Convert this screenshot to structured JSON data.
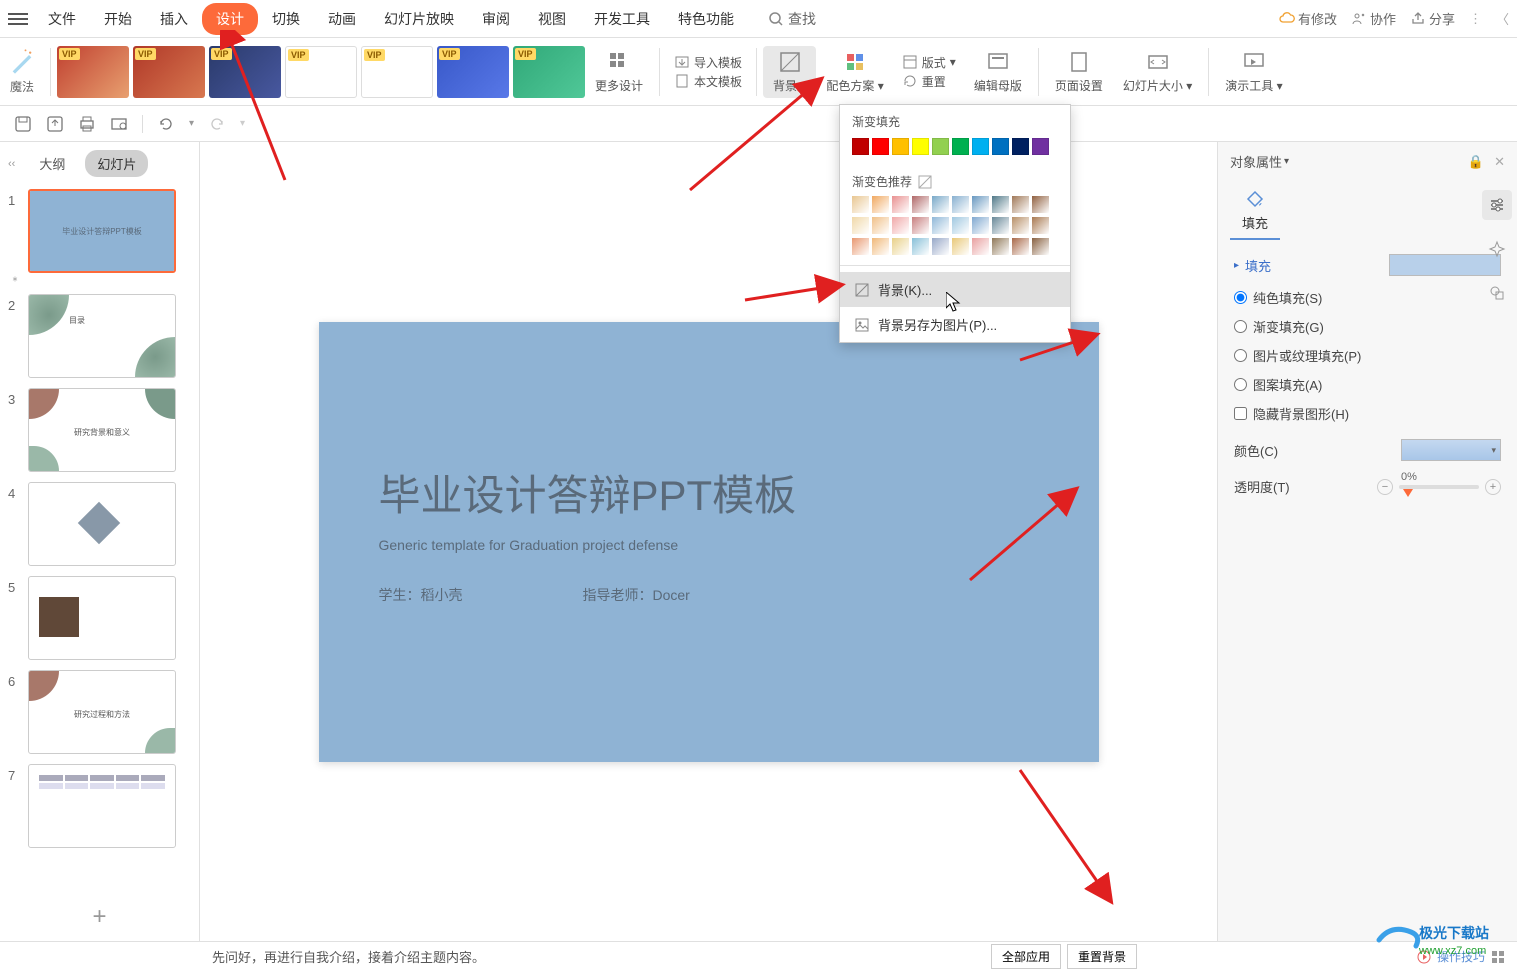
{
  "menu": {
    "items": [
      "文件",
      "开始",
      "插入",
      "设计",
      "切换",
      "动画",
      "幻灯片放映",
      "审阅",
      "视图",
      "开发工具",
      "特色功能"
    ],
    "active_index": 3,
    "search": "查找",
    "right": {
      "modified": "有修改",
      "collab": "协作",
      "share": "分享"
    }
  },
  "ribbon": {
    "magic": "魔法",
    "vip_badge": "VIP",
    "more_design": "更多设计",
    "import_tpl": "导入模板",
    "doc_tpl": "本文模板",
    "background": "背景",
    "color_scheme": "配色方案",
    "layout": "版式",
    "reset": "重置",
    "edit_master": "编辑母版",
    "page_setup": "页面设置",
    "slide_size": "幻灯片大小",
    "present_tools": "演示工具"
  },
  "sidebar": {
    "tabs": {
      "outline": "大纲",
      "slides": "幻灯片"
    },
    "thumbs": [
      {
        "num": "1",
        "title": "毕业设计答辩PPT模板"
      },
      {
        "num": "2",
        "title": "目录"
      },
      {
        "num": "3",
        "title": "研究背景和意义"
      },
      {
        "num": "4",
        "title": ""
      },
      {
        "num": "5",
        "title": ""
      },
      {
        "num": "6",
        "title": "研究过程和方法"
      },
      {
        "num": "7",
        "title": ""
      }
    ]
  },
  "slide": {
    "title": "毕业设计答辩PPT模板",
    "subtitle": "Generic template for Graduation project defense",
    "student_label": "学生：",
    "student_name": "稻小壳",
    "teacher_label": "指导老师：",
    "teacher_name": "Docer"
  },
  "bg_panel": {
    "gradient_fill": "渐变填充",
    "gradient_rec": "渐变色推荐",
    "preset_colors": [
      "#c00000",
      "#ff0000",
      "#ffc000",
      "#ffff00",
      "#92d050",
      "#00b050",
      "#00b0f0",
      "#0070c0",
      "#002060",
      "#7030a0"
    ],
    "grad_row1": [
      "#e8c690",
      "#f0a860",
      "#e89090",
      "#b06868",
      "#78a8c8",
      "#88b0d0",
      "#6898c0",
      "#507888",
      "#a07858",
      "#906040"
    ],
    "grad_row2": [
      "#f0d8a8",
      "#f0c088",
      "#f0a8a8",
      "#c88080",
      "#90b8d8",
      "#a0c8e0",
      "#80a8d0",
      "#688898",
      "#b89068",
      "#a87850"
    ],
    "grad_row3": [
      "#e89870",
      "#f0b878",
      "#e8d088",
      "#88c0d8",
      "#98a8c8",
      "#e8c878",
      "#e8a0a0",
      "#907858",
      "#a86848",
      "#886040"
    ],
    "bg_menu": "背景(K)...",
    "save_as_pic": "背景另存为图片(P)..."
  },
  "right_panel": {
    "title": "对象属性",
    "tab_fill": "填充",
    "section_fill": "填充",
    "solid_fill": "纯色填充(S)",
    "gradient_fill": "渐变填充(G)",
    "pic_texture_fill": "图片或纹理填充(P)",
    "pattern_fill": "图案填充(A)",
    "hide_bg_shape": "隐藏背景图形(H)",
    "color_label": "颜色(C)",
    "transparency_label": "透明度(T)",
    "transparency_value": "0%"
  },
  "footer": {
    "text": "先问好，再进行自我介绍，接着介绍主题内容。",
    "apply_all": "全部应用",
    "reset_bg": "重置背景",
    "op_tips": "操作技巧"
  },
  "watermark": {
    "line1": "极光下载站",
    "line2": "www.xz7.com"
  }
}
